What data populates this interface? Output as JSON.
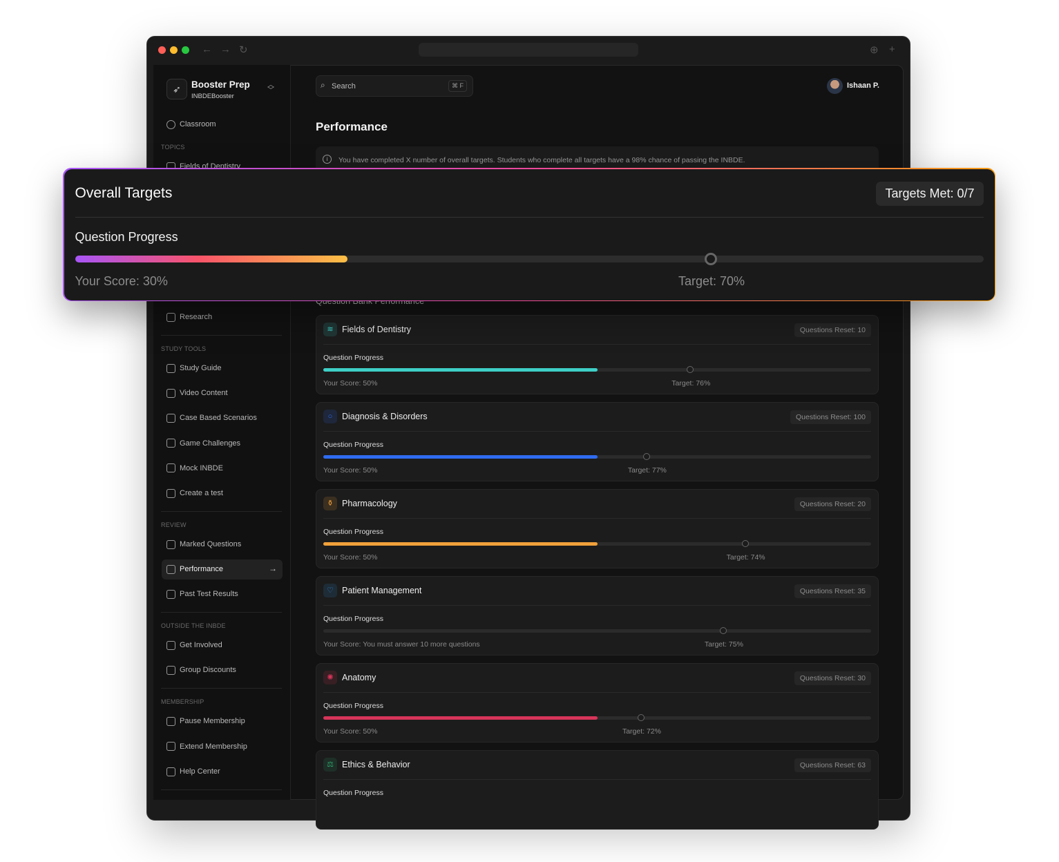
{
  "window": {
    "traffic_colors": [
      "#ff5f57",
      "#febc2e",
      "#28c840"
    ]
  },
  "sidebar": {
    "brand": {
      "name": "Booster Prep",
      "sub": "INBDEBooster"
    },
    "classroom": "Classroom",
    "topics_label": "TOPICS",
    "topic_first": "Fields of Dentistry",
    "research": "Research",
    "study_tools_label": "STUDY TOOLS",
    "study_tools": [
      "Study Guide",
      "Video Content",
      "Case Based Scenarios",
      "Game Challenges",
      "Mock INBDE",
      "Create a test"
    ],
    "review_label": "REVIEW",
    "review": [
      "Marked Questions",
      "Performance",
      "Past Test Results"
    ],
    "outside_label": "OUTSIDE THE INBDE",
    "outside": [
      "Get Involved",
      "Group Discounts"
    ],
    "membership_label": "MEMBERSHIP",
    "membership": [
      "Pause Membership",
      "Extend Membership",
      "Help Center"
    ]
  },
  "header": {
    "search_placeholder": "Search",
    "search_shortcut": "⌘ F",
    "user_name": "Ishaan P."
  },
  "main": {
    "title": "Performance",
    "info": "You have completed X number of overall targets. Students who complete all targets have a 98% chance of passing the INBDE.",
    "section_title": "Question Bank Performance",
    "cards": [
      {
        "title": "Fields of Dentistry",
        "badge": "Questions Reset: 10",
        "progress_label": "Question Progress",
        "score_text": "Your Score: 50%",
        "score": 50,
        "target_text": "Target: 76%",
        "target": 67,
        "color": "#3ecfc7",
        "icon": "books-icon",
        "icon_glyph": "≋"
      },
      {
        "title": "Diagnosis & Disorders",
        "badge": "Questions Reset: 100",
        "progress_label": "Question Progress",
        "score_text": "Your Score: 50%",
        "score": 50,
        "target_text": "Target: 77%",
        "target": 59,
        "color": "#2f6bf0",
        "icon": "search-icon",
        "icon_glyph": "○"
      },
      {
        "title": "Pharmacology",
        "badge": "Questions Reset: 20",
        "progress_label": "Question Progress",
        "score_text": "Your Score: 50%",
        "score": 50,
        "target_text": "Target: 74%",
        "target": 77,
        "color": "#f0a03a",
        "icon": "pill-bottle-icon",
        "icon_glyph": "⚱"
      },
      {
        "title": "Patient Management",
        "badge": "Questions Reset: 35",
        "progress_label": "Question Progress",
        "score_text": "Your Score: You must answer 10 more questions",
        "score": 0,
        "target_text": "Target: 75%",
        "target": 73,
        "color": "#2f8bd8",
        "icon": "stethoscope-icon",
        "icon_glyph": "♡"
      },
      {
        "title": "Anatomy",
        "badge": "Questions Reset: 30",
        "progress_label": "Question Progress",
        "score_text": "Your Score: 50%",
        "score": 50,
        "target_text": "Target: 72%",
        "target": 58,
        "color": "#d63459",
        "icon": "brain-icon",
        "icon_glyph": "✺"
      },
      {
        "title": "Ethics & Behavior",
        "badge": "Questions Reset: 63",
        "progress_label": "Question Progress",
        "color": "#2fa36b",
        "icon": "scales-icon",
        "icon_glyph": "⚖"
      }
    ]
  },
  "overall": {
    "title": "Overall Targets",
    "badge": "Targets Met: 0/7",
    "progress_label": "Question Progress",
    "score_text": "Your Score: 30%",
    "score": 30,
    "target_text": "Target: 70%",
    "target": 70
  }
}
